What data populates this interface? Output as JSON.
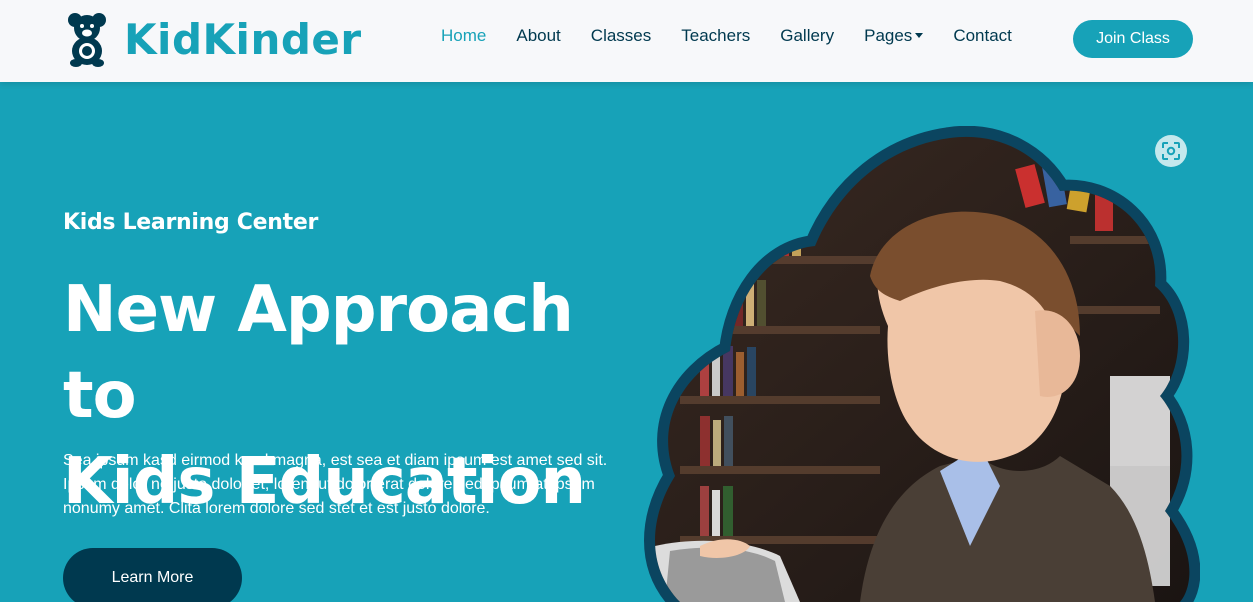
{
  "brand": {
    "name": "KidKinder",
    "color": "#17a2b8",
    "icon": "teddy-bear-icon"
  },
  "nav": {
    "items": [
      {
        "label": "Home",
        "active": true
      },
      {
        "label": "About"
      },
      {
        "label": "Classes"
      },
      {
        "label": "Teachers"
      },
      {
        "label": "Gallery"
      },
      {
        "label": "Pages",
        "dropdown": true
      },
      {
        "label": "Contact"
      }
    ],
    "cta_label": "Join Class"
  },
  "hero": {
    "subtitle": "Kids Learning Center",
    "headline_line1": "New Approach to",
    "headline_line2": "Kids Education",
    "description": "Sea ipsum kasd eirmod kasd magna, est sea et diam ipsum est amet sed sit. Ipsum dolor no justo dolor et, lorem ut dolor erat dolore sed ipsum at ipsum nonumy amet. Clita lorem dolore sed stet et est justo dolore.",
    "button_label": "Learn More",
    "image_icon": "visual-search-icon"
  },
  "colors": {
    "primary": "#17a2b8",
    "dark": "#00394f",
    "navbar_bg": "#f7f8fa"
  }
}
